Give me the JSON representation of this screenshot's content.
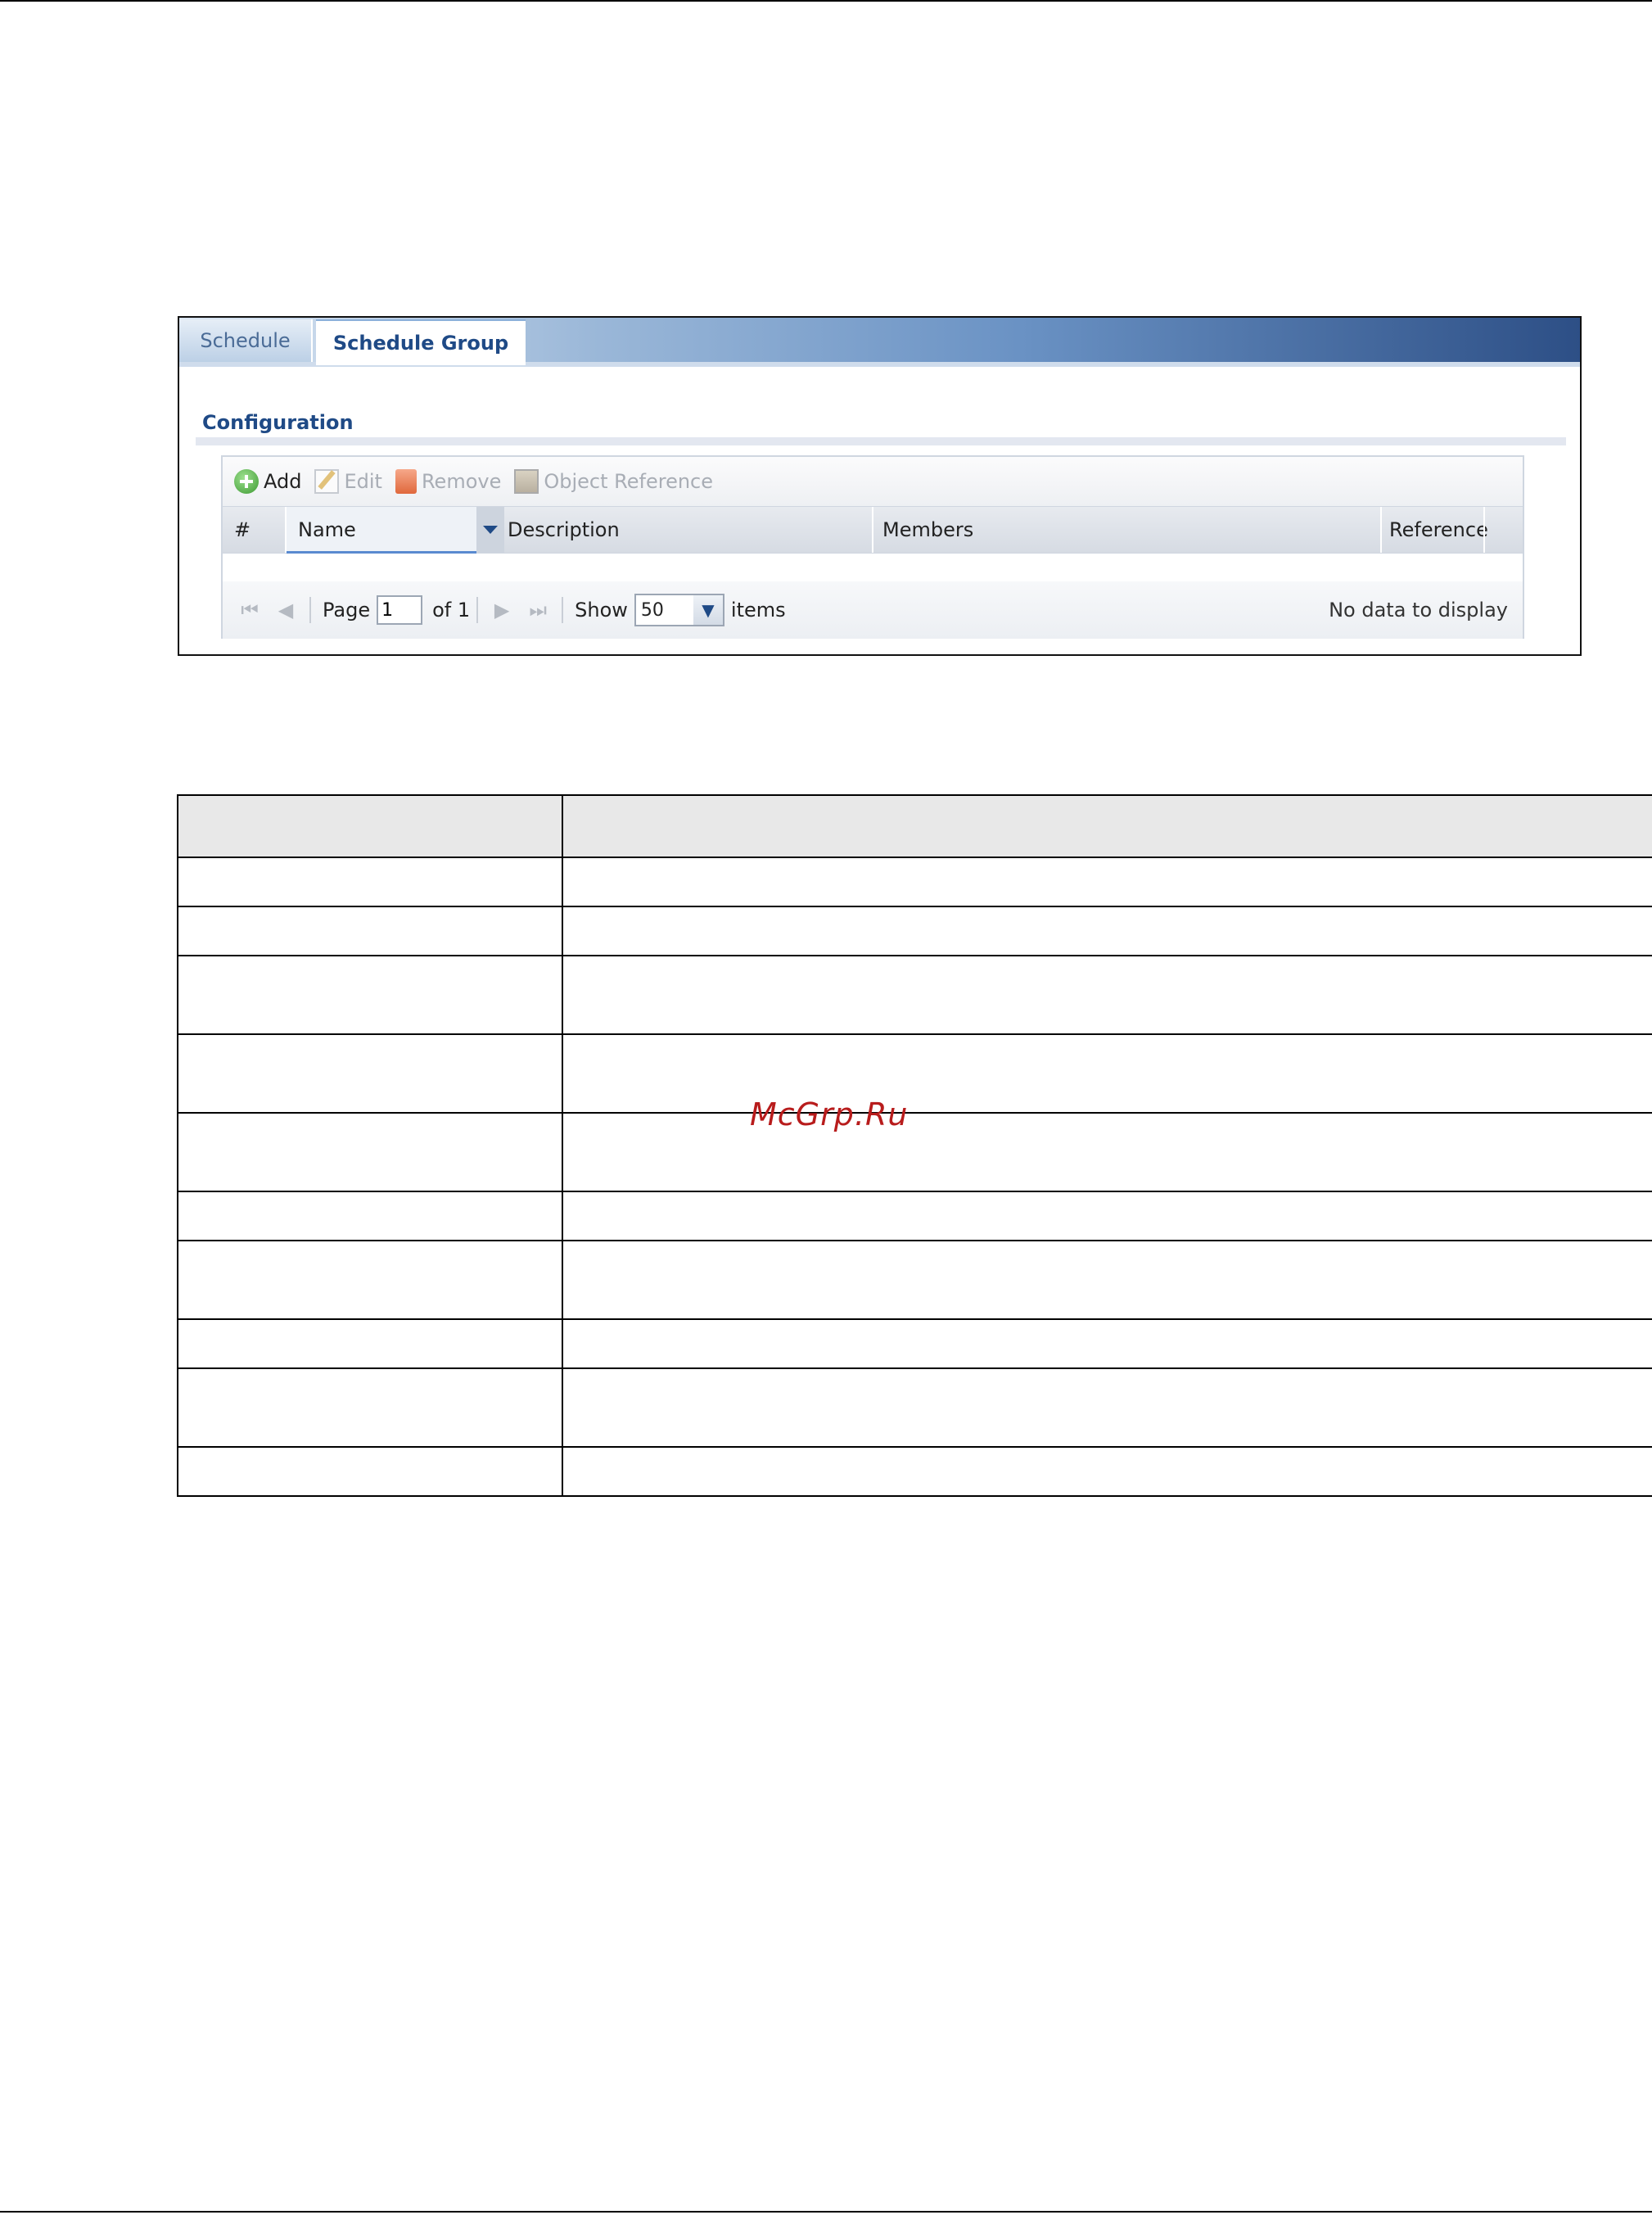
{
  "tabs": [
    {
      "label": "Schedule",
      "active": false
    },
    {
      "label": "Schedule Group",
      "active": true
    }
  ],
  "section_title": "Configuration",
  "toolbar": {
    "add": "Add",
    "edit": "Edit",
    "remove": "Remove",
    "object_reference": "Object Reference"
  },
  "table": {
    "columns": [
      "#",
      "Name",
      "Description",
      "Members",
      "Reference"
    ],
    "rows": []
  },
  "pager": {
    "page_label": "Page",
    "page_value": "1",
    "of_label": "of 1",
    "show_label": "Show",
    "show_value": "50",
    "items_label": "items",
    "status": "No data to display"
  },
  "watermark": "McGrp.Ru",
  "colors": {
    "accent": "#1f4a86",
    "tab_gradient_end": "#2d4f86",
    "add_icon": "#3d9a32",
    "watermark": "#b81c1c"
  },
  "icons": [
    "add-icon",
    "edit-icon",
    "remove-icon",
    "object-reference-icon",
    "first-page-icon",
    "prev-page-icon",
    "next-page-icon",
    "last-page-icon",
    "chevron-down-icon",
    "sort-desc-icon"
  ]
}
